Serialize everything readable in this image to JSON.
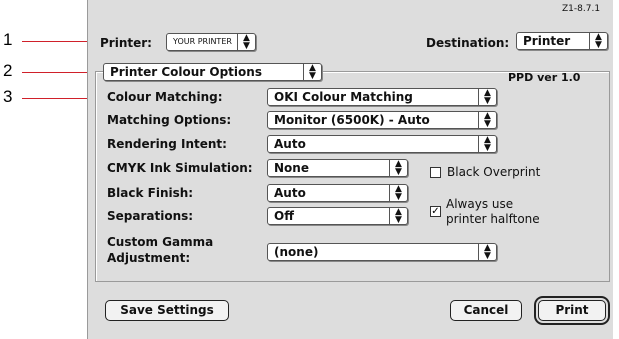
{
  "callouts": [
    "1",
    "2",
    "3"
  ],
  "version": "Z1-8.7.1",
  "printer": {
    "label": "Printer:",
    "value": "YOUR PRINTER"
  },
  "destination": {
    "label": "Destination:",
    "value": "Printer"
  },
  "panel_select": "Printer Colour Options",
  "ppd_version": "PPD ver 1.0",
  "rows": [
    {
      "label": "Colour Matching:",
      "value": "OKI Colour Matching"
    },
    {
      "label": "Matching Options:",
      "value": "Monitor (6500K) - Auto"
    },
    {
      "label": "Rendering Intent:",
      "value": "Auto"
    },
    {
      "label": "CMYK Ink Simulation:",
      "value": "None"
    },
    {
      "label": "Black Finish:",
      "value": "Auto"
    },
    {
      "label": "Separations:",
      "value": "Off"
    },
    {
      "label": "Custom Gamma",
      "label2": "Adjustment:",
      "value": "(none)"
    }
  ],
  "checkboxes": {
    "black_overprint": {
      "label": "Black Overprint",
      "checked": false
    },
    "halftone": {
      "label": "Always use",
      "label2": "printer halftone",
      "checked": true
    }
  },
  "buttons": {
    "save": "Save Settings",
    "cancel": "Cancel",
    "print": "Print"
  },
  "colors": {
    "callout": "#d0202a",
    "dialog_bg": "#dddddd"
  }
}
